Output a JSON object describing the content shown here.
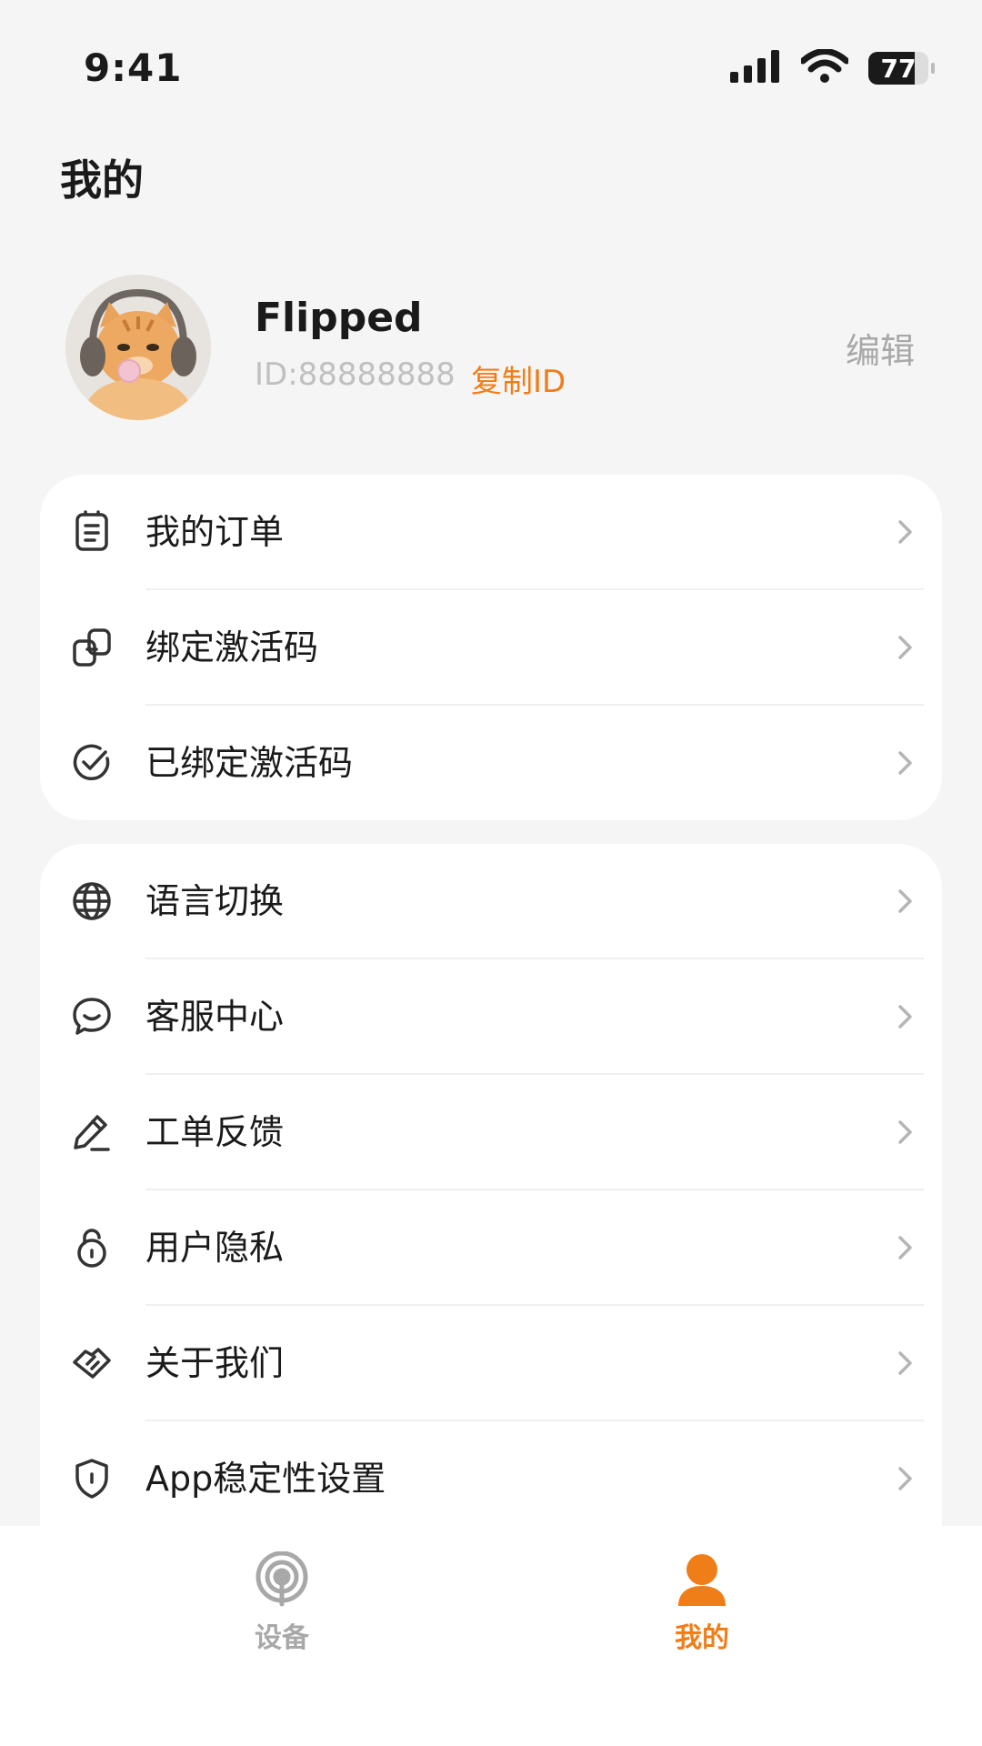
{
  "status_bar": {
    "time": "9:41",
    "battery_level": "77",
    "battery_fraction": 0.77
  },
  "header": {
    "title": "我的"
  },
  "profile": {
    "name": "Flipped",
    "id_text": "ID:88888888",
    "copy_id_label": "复制ID",
    "edit_label": "编辑"
  },
  "menu_group_1": [
    {
      "label": "我的订单",
      "icon": "order-list-icon"
    },
    {
      "label": "绑定激活码",
      "icon": "link-code-icon"
    },
    {
      "label": "已绑定激活码",
      "icon": "check-circle-icon"
    }
  ],
  "menu_group_2": [
    {
      "label": "语言切换",
      "icon": "globe-icon"
    },
    {
      "label": "客服中心",
      "icon": "chat-smile-icon"
    },
    {
      "label": "工单反馈",
      "icon": "pencil-icon"
    },
    {
      "label": "用户隐私",
      "icon": "lock-icon"
    },
    {
      "label": "关于我们",
      "icon": "handshake-icon"
    },
    {
      "label": "App稳定性设置",
      "icon": "shield-icon"
    }
  ],
  "tab_bar": {
    "tabs": [
      {
        "label": "设备",
        "icon": "device-signal-icon",
        "active": false
      },
      {
        "label": "我的",
        "icon": "person-icon",
        "active": true
      }
    ]
  },
  "colors": {
    "accent": "#f07e18",
    "background": "#f5f5f5",
    "card": "#ffffff",
    "muted_text": "#a8a8a8"
  }
}
